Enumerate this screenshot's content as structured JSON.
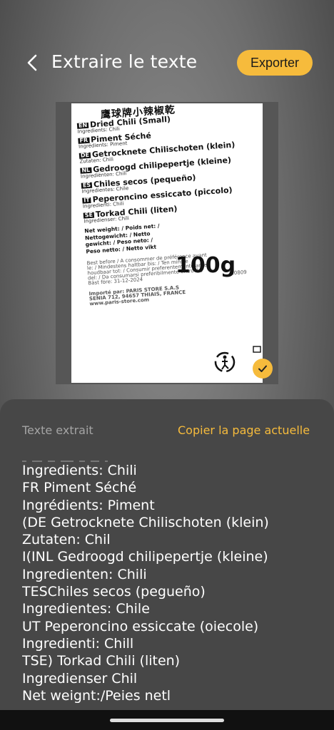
{
  "header": {
    "title": "Extraire le texte",
    "export_label": "Exporter"
  },
  "preview": {
    "chinese_title": "鹰球牌小辣椒乾",
    "lines": [
      {
        "code": "EN",
        "text": "Dried Chili (Small)",
        "sub": "Ingredients: Chili"
      },
      {
        "code": "FR",
        "text": "Piment Séché",
        "sub": "Ingrédients: Piment"
      },
      {
        "code": "DE",
        "text": "Getrocknete Chilischoten (klein)",
        "sub": "Zutaten: Chili"
      },
      {
        "code": "NL",
        "text": "Gedroogd chilipepertje (kleine)",
        "sub": "Ingrediënten: Chili"
      },
      {
        "code": "ES",
        "text": "Chiles secos (pequeño)",
        "sub": "Ingredientes: Chile"
      },
      {
        "code": "IT",
        "text": "Peperoncino essiccato (piccolo)",
        "sub": "Ingredienti: Chili"
      },
      {
        "code": "SE",
        "text": "Torkad Chili (liten)",
        "sub": "Ingredienser: Chili"
      }
    ],
    "weight_lines": [
      "Net weight: / Poids net: /",
      "Nettogewicht: / Netto",
      "gewicht: / Peso neto: /",
      "Peso netto: / Netto vikt"
    ],
    "weight_value": "100g",
    "best_before": [
      "Best before / A consommer de préférence avant",
      "le: / Mindestens haltbar bis: / Ten minste",
      "houdbaar tot: / Consumir preferentemente antes",
      "del: / Da consumarsi preferibilmente entro il: /",
      "Bäst före: 31-12-2024"
    ],
    "lot": "220809",
    "importer": [
      "Importé par: PARIS STORE S.A.S",
      "SENIA 712, 94657 THIAIS, FRANCE",
      "www.paris-store.com"
    ]
  },
  "sheet": {
    "title": "Texte extrait",
    "copy_label": "Copier la page actuelle",
    "extracted_lines": [
      "Ingredients: Chili",
      "FR Piment Séché",
      "Ingrédients: Piment",
      "(DE Getrocknete Chilischoten (klein)",
      "Zutaten: Chil",
      "I(INL Gedroogd chilipepertje (kleine)",
      "Ingredienten: Chili",
      "TESChiles secos (pegueño)",
      "Ingredientes: Chile",
      "UT Peperoncino essiccate (oiecole)",
      "Ingredienti: Chill",
      "TSE) Torkad Chili (liten)",
      "Ingredienser Chil",
      "Net weignt:/Peies netl"
    ]
  },
  "colors": {
    "accent": "#f6bb3c",
    "sheet_bg": "#474747",
    "muted_text": "#a4a4a4"
  },
  "icons": {
    "back": "arrow-left-icon",
    "check": "check-icon",
    "recycle": "recycle-person-icon"
  }
}
